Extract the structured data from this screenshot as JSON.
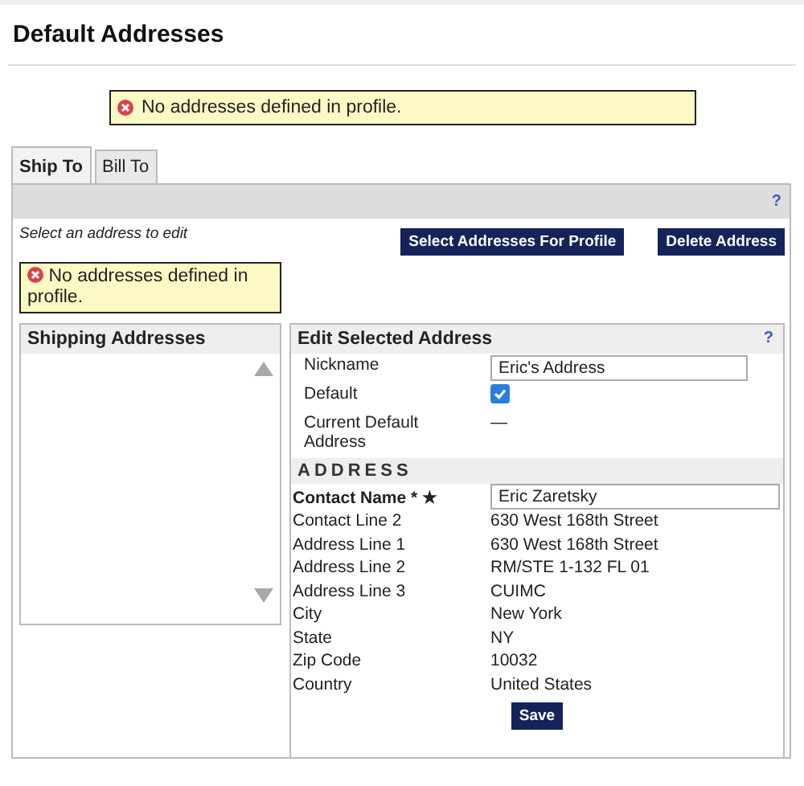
{
  "page_title": "Default Addresses",
  "top_message": "No addresses defined in profile.",
  "tabs": [
    {
      "label": "Ship To",
      "selected": true
    },
    {
      "label": "Bill To",
      "selected": false
    }
  ],
  "help_label": "?",
  "instruction": "Select an address to edit",
  "buttons": [
    "Select Addresses For Profile",
    "Delete Address"
  ],
  "panel_message": "No addresses defined in profile.",
  "shipping_panel": {
    "title": "Shipping Addresses"
  },
  "edit_panel": {
    "title": "Edit Selected Address",
    "help_label": "?",
    "general_fields": [
      {
        "kind": "input",
        "label": "Nickname",
        "value": "Eric's Address"
      },
      {
        "kind": "checkbox",
        "label": "Default",
        "checked": true
      },
      {
        "kind": "text",
        "label": "Current Default Address",
        "value": "—"
      }
    ],
    "section_title": "ADDRESS",
    "address_fields": [
      {
        "kind": "input",
        "label": "Contact Name * ★",
        "value": "Eric Zaretsky",
        "required": true
      },
      {
        "kind": "text",
        "label": "Contact Line 2",
        "value": "630 West 168th Street",
        "required": false
      },
      {
        "kind": "text",
        "label": "Address Line 1",
        "value": "630 West 168th Street",
        "required": false
      },
      {
        "kind": "text",
        "label": "Address Line 2",
        "value": "RM/STE 1-132 FL 01",
        "required": false
      },
      {
        "kind": "text",
        "label": "Address Line 3",
        "value": "CUIMC",
        "required": false
      },
      {
        "kind": "text",
        "label": "City",
        "value": "New York",
        "required": false
      },
      {
        "kind": "text",
        "label": "State",
        "value": "NY",
        "required": false
      },
      {
        "kind": "text",
        "label": "Zip Code",
        "value": "10032",
        "required": false
      },
      {
        "kind": "text",
        "label": "Country",
        "value": "United States",
        "required": false
      }
    ],
    "save_button": "Save"
  }
}
